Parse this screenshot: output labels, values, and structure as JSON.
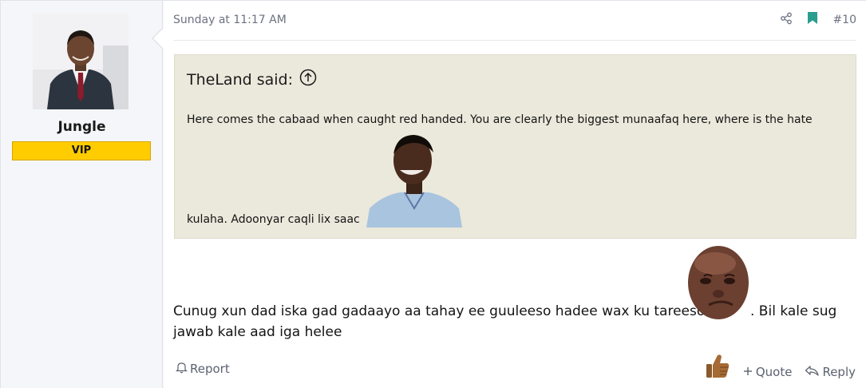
{
  "user": {
    "name": "Jungle",
    "badge": "VIP",
    "badge_color": "#ffcc00"
  },
  "post": {
    "timestamp": "Sunday at 11:17 AM",
    "number": "#10",
    "share_icon": "share-icon",
    "bookmark_icon": "bookmark-icon",
    "bookmark_color": "#2a9d8f"
  },
  "quote": {
    "author_label": "TheLand said:",
    "expand_icon": "arrow-up-circle-icon",
    "line1": "Here comes the cabaad when caught red handed. You are clearly the biggest munaafaq here, where is the hate",
    "line2": "kulaha. Adoonyar caqli lix saac",
    "background": "#ebe9dc"
  },
  "message": {
    "line1": "Cunug xun dad iska gad gadaayo aa tahay ee guuleeso hadee wax ku tareeso",
    "line1_end": ". Bil kale sug",
    "line2": "jawab kale aad iga helee"
  },
  "actions": {
    "report": "Report",
    "quote": "Quote",
    "reply": "Reply",
    "reaction_icon": "thumbs-up-icon"
  }
}
